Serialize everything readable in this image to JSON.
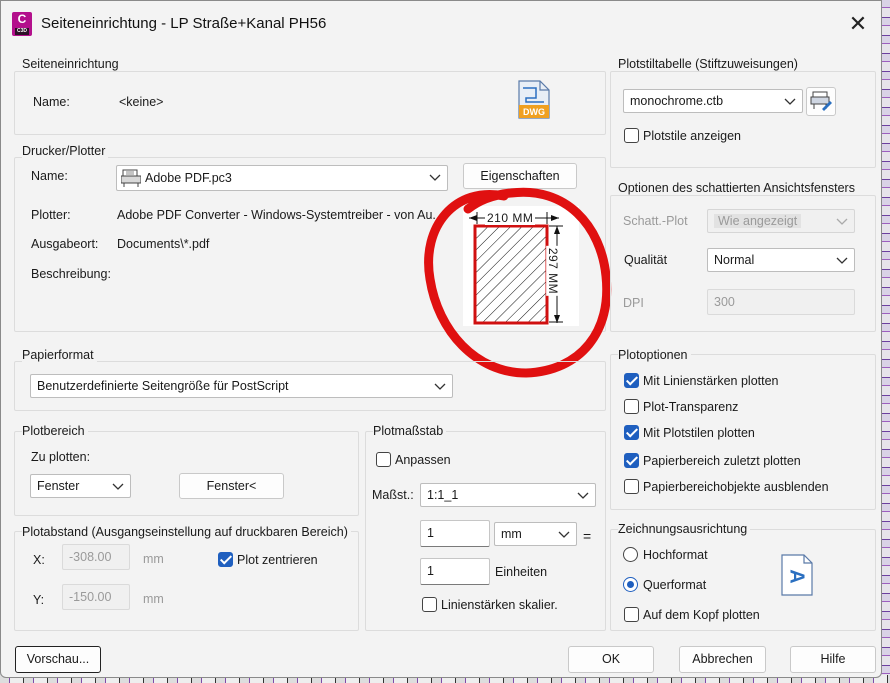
{
  "window": {
    "title": "Seiteneinrichtung - LP Straße+Kanal PH56",
    "app_icon_letter": "C",
    "app_icon_sub": "C3D"
  },
  "page_setup": {
    "group_label": "Seiteneinrichtung",
    "name_label": "Name:",
    "name_value": "<keine>",
    "dwg_icon_text": "DWG"
  },
  "printer": {
    "group_label": "Drucker/Plotter",
    "name_label": "Name:",
    "name_value": "Adobe PDF.pc3",
    "properties_button": "Eigenschaften",
    "plotter_label": "Plotter:",
    "plotter_value": "Adobe PDF Converter - Windows-Systemtreiber - von Au...",
    "location_label": "Ausgabeort:",
    "location_value": "Documents\\*.pdf",
    "description_label": "Beschreibung:",
    "paper_width": "210 MM",
    "paper_height": "297 MM"
  },
  "paper_format": {
    "group_label": "Papierformat",
    "value": "Benutzerdefinierte Seitengröße für PostScript"
  },
  "plot_area": {
    "group_label": "Plotbereich",
    "what_label": "Zu plotten:",
    "what_value": "Fenster",
    "window_button": "Fenster<"
  },
  "plot_offset": {
    "group_label": "Plotabstand (Ausgangseinstellung auf druckbaren Bereich)",
    "x_label": "X:",
    "x_value": "-308.00",
    "y_label": "Y:",
    "y_value": "-150.00",
    "unit": "mm",
    "center_label": "Plot zentrieren",
    "center_checked": true
  },
  "plot_scale": {
    "group_label": "Plotmaßstab",
    "fit_label": "Anpassen",
    "fit_checked": false,
    "scale_label": "Maßst.:",
    "scale_value": "1:1_1",
    "value1": "1",
    "unit_value": "mm",
    "equals": "=",
    "value2": "1",
    "units_label": "Einheiten",
    "lineweight_label": "Linienstärken skalier.",
    "lineweight_checked": false
  },
  "plot_style_table": {
    "group_label": "Plotstiltabelle (Stiftzuweisungen)",
    "value": "monochrome.ctb",
    "show_label": "Plotstile anzeigen",
    "show_checked": false
  },
  "shaded_viewport": {
    "group_label": "Optionen des schattierten Ansichtsfensters",
    "shade_label": "Schatt.-Plot",
    "shade_value": "Wie angezeigt",
    "quality_label": "Qualität",
    "quality_value": "Normal",
    "dpi_label": "DPI",
    "dpi_value": "300"
  },
  "plot_options": {
    "group_label": "Plotoptionen",
    "items": [
      {
        "label": "Mit Linienstärken plotten",
        "checked": true
      },
      {
        "label": "Plot-Transparenz",
        "checked": false
      },
      {
        "label": "Mit Plotstilen plotten",
        "checked": true
      },
      {
        "label": "Papierbereich zuletzt plotten",
        "checked": true
      },
      {
        "label": "Papierbereichobjekte ausblenden",
        "checked": false
      }
    ]
  },
  "orientation": {
    "group_label": "Zeichnungsausrichtung",
    "portrait_label": "Hochformat",
    "landscape_label": "Querformat",
    "selected": "Querformat",
    "upside_down_label": "Auf dem Kopf plotten",
    "upside_down_checked": false,
    "icon_letter": "A"
  },
  "footer": {
    "preview_button": "Vorschau...",
    "ok_button": "OK",
    "cancel_button": "Abbrechen",
    "help_button": "Hilfe"
  },
  "colors": {
    "accent": "#1f5fbf",
    "annotation_red": "#e01010",
    "app_icon": "#b3108c"
  }
}
